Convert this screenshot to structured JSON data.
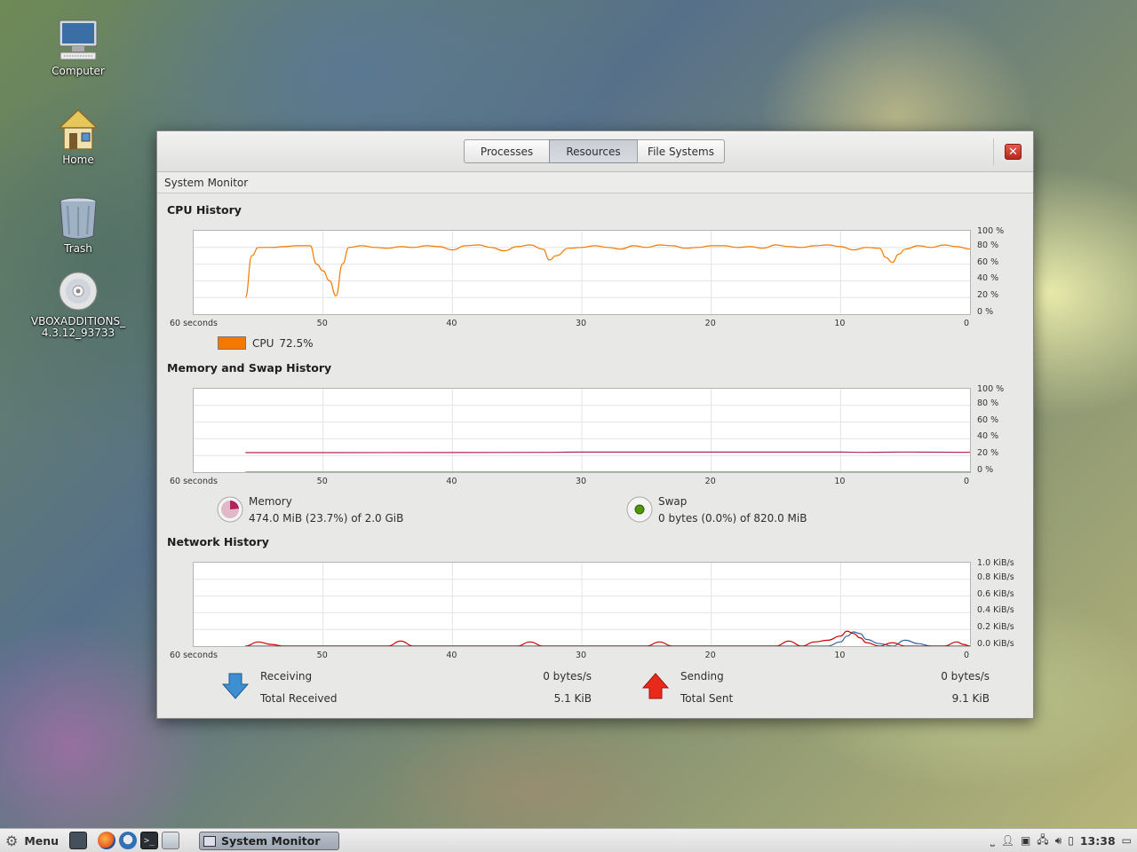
{
  "desktop": {
    "icons": [
      {
        "label": "Computer"
      },
      {
        "label": "Home"
      },
      {
        "label": "Trash"
      },
      {
        "label_line1": "VBOXADDITIONS_",
        "label_line2": "4.3.12_93733"
      }
    ]
  },
  "window": {
    "tabs": [
      "Processes",
      "Resources",
      "File Systems"
    ],
    "active_tab": "Resources",
    "subtitle": "System Monitor",
    "close_icon": "close-icon"
  },
  "cpu": {
    "title": "CPU History",
    "legend_label": "CPU",
    "legend_value": "72.5%",
    "legend_color": "#f57900",
    "y_ticks": [
      "100 %",
      "80 %",
      "60 %",
      "40 %",
      "20 %",
      "0 %"
    ],
    "x_ticks": [
      "60 seconds",
      "50",
      "40",
      "30",
      "20",
      "10",
      "0"
    ]
  },
  "memory": {
    "title": "Memory and Swap History",
    "y_ticks": [
      "100 %",
      "80 %",
      "60 %",
      "40 %",
      "20 %",
      "0 %"
    ],
    "x_ticks": [
      "60 seconds",
      "50",
      "40",
      "30",
      "20",
      "10",
      "0"
    ],
    "memory_label": "Memory",
    "memory_value": "474.0 MiB (23.7%) of 2.0 GiB",
    "memory_color": "#b0235b",
    "swap_label": "Swap",
    "swap_value": "0 bytes (0.0%) of 820.0 MiB",
    "swap_color": "#4e9a06"
  },
  "network": {
    "title": "Network History",
    "y_ticks": [
      "1.0 KiB/s",
      "0.8 KiB/s",
      "0.6 KiB/s",
      "0.4 KiB/s",
      "0.2 KiB/s",
      "0.0 KiB/s"
    ],
    "x_ticks": [
      "60 seconds",
      "50",
      "40",
      "30",
      "20",
      "10",
      "0"
    ],
    "receiving_label": "Receiving",
    "receiving_value": "0 bytes/s",
    "total_received_label": "Total Received",
    "total_received_value": "5.1 KiB",
    "sending_label": "Sending",
    "sending_value": "0 bytes/s",
    "total_sent_label": "Total Sent",
    "total_sent_value": "9.1 KiB",
    "receiving_color": "#3465a4",
    "sending_color": "#cc0000"
  },
  "taskbar": {
    "menu_label": "Menu",
    "task_label": "System Monitor",
    "clock": "13:38"
  },
  "chart_data": [
    {
      "type": "line",
      "title": "CPU History",
      "xlabel": "",
      "ylabel": "",
      "x": [
        56,
        55.5,
        55,
        54,
        53,
        52,
        51,
        50.5,
        50,
        49.5,
        49,
        48.5,
        48,
        47,
        46,
        45,
        44,
        43,
        42,
        41,
        40,
        39,
        38,
        37,
        36,
        35,
        34,
        33,
        32.5,
        32,
        31,
        30,
        29,
        28,
        27,
        26,
        25,
        24,
        23,
        22,
        21,
        20,
        19,
        18,
        17,
        16,
        15,
        14,
        13,
        12,
        11,
        10,
        9,
        8,
        7,
        6.5,
        6,
        5.5,
        5,
        4,
        3,
        2,
        1,
        0
      ],
      "series": [
        {
          "name": "CPU",
          "values": [
            20,
            70,
            80,
            80,
            81,
            82,
            82,
            60,
            52,
            40,
            22,
            60,
            80,
            82,
            80,
            79,
            81,
            80,
            82,
            81,
            77,
            82,
            83,
            80,
            76,
            81,
            83,
            78,
            65,
            70,
            79,
            80,
            82,
            80,
            78,
            82,
            80,
            83,
            82,
            79,
            80,
            82,
            82,
            80,
            81,
            79,
            83,
            81,
            80,
            82,
            83,
            81,
            77,
            80,
            79,
            68,
            62,
            72,
            78,
            82,
            80,
            83,
            81,
            78
          ]
        }
      ],
      "ylim": [
        0,
        100
      ],
      "xlim": [
        60,
        0
      ],
      "grid": true,
      "legend": "bottom-left"
    },
    {
      "type": "line",
      "title": "Memory and Swap History",
      "xlabel": "",
      "ylabel": "",
      "x": [
        56,
        50,
        40,
        33,
        30,
        20,
        10,
        8,
        5,
        0
      ],
      "series": [
        {
          "name": "Memory",
          "values": [
            23.4,
            23.4,
            23.5,
            23.7,
            24.0,
            24.0,
            24.0,
            23.7,
            24.2,
            23.7
          ]
        },
        {
          "name": "Swap",
          "values": [
            0,
            0,
            0,
            0,
            0,
            0,
            0,
            0,
            0,
            0
          ]
        }
      ],
      "ylim": [
        0,
        100
      ],
      "xlim": [
        60,
        0
      ],
      "grid": true,
      "legend": "bottom"
    },
    {
      "type": "line",
      "title": "Network History",
      "xlabel": "",
      "ylabel": "",
      "x": [
        56,
        55,
        54,
        53,
        45,
        44,
        43,
        35,
        34,
        33,
        25,
        24,
        23,
        15,
        14,
        13,
        12,
        11,
        10,
        9.5,
        9,
        8.5,
        8,
        7,
        6,
        5,
        4,
        3,
        2,
        1,
        0.5,
        0
      ],
      "series": [
        {
          "name": "Receiving",
          "values": [
            0,
            0,
            0,
            0,
            0,
            0,
            0,
            0,
            0,
            0,
            0,
            0,
            0,
            0,
            0,
            0,
            0,
            0,
            0.05,
            0.12,
            0.17,
            0.15,
            0.08,
            0.03,
            0,
            0.07,
            0.03,
            0,
            0,
            0,
            0,
            0
          ]
        },
        {
          "name": "Sending",
          "values": [
            0,
            0.05,
            0.02,
            0,
            0,
            0.06,
            0,
            0,
            0.05,
            0,
            0,
            0.05,
            0,
            0,
            0.06,
            0,
            0.05,
            0.07,
            0.12,
            0.18,
            0.15,
            0.1,
            0.04,
            0,
            0.04,
            0,
            0,
            0,
            0,
            0.05,
            0.02,
            0
          ]
        }
      ],
      "ylim": [
        0,
        1.0
      ],
      "xlim": [
        60,
        0
      ],
      "grid": true,
      "legend": "bottom"
    }
  ]
}
